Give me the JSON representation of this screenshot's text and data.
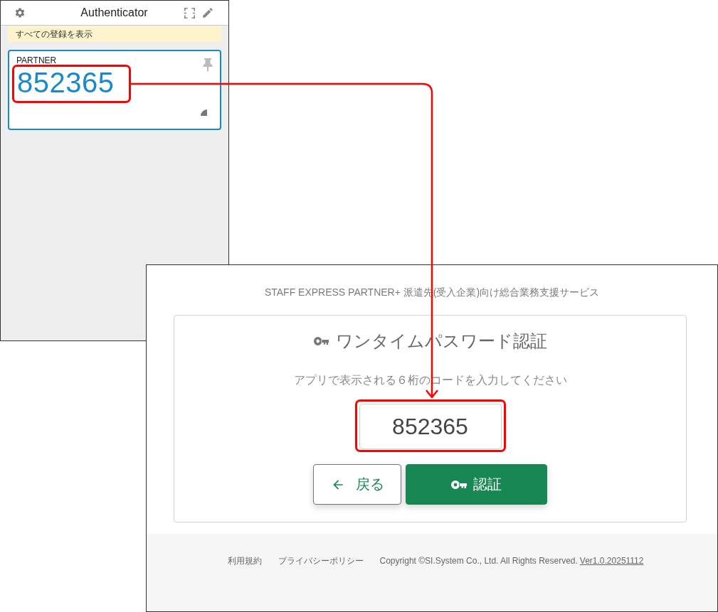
{
  "authenticator": {
    "title": "Authenticator",
    "filter_banner": "すべての登録を表示",
    "accounts": [
      {
        "issuer": "PARTNER",
        "code": "852365"
      }
    ]
  },
  "otp_page": {
    "service_title": "STAFF EXPRESS PARTNER+ 派遣先(受入企業)向け総合業務支援サービス",
    "heading": "ワンタイムパスワード認証",
    "instruction": "アプリで表示される６桁のコードを入力してください",
    "code_field": {
      "value": "852365"
    },
    "buttons": [
      {
        "kind": "back",
        "label": "戻る"
      },
      {
        "kind": "submit",
        "label": "認証"
      }
    ],
    "footer": {
      "links": [
        "利用規約",
        "プライバシーポリシー"
      ],
      "copyright": "Copyright ©SI.System Co., Ltd. All Rights Reserved.",
      "version_link": "Ver1.0.20251112"
    }
  }
}
